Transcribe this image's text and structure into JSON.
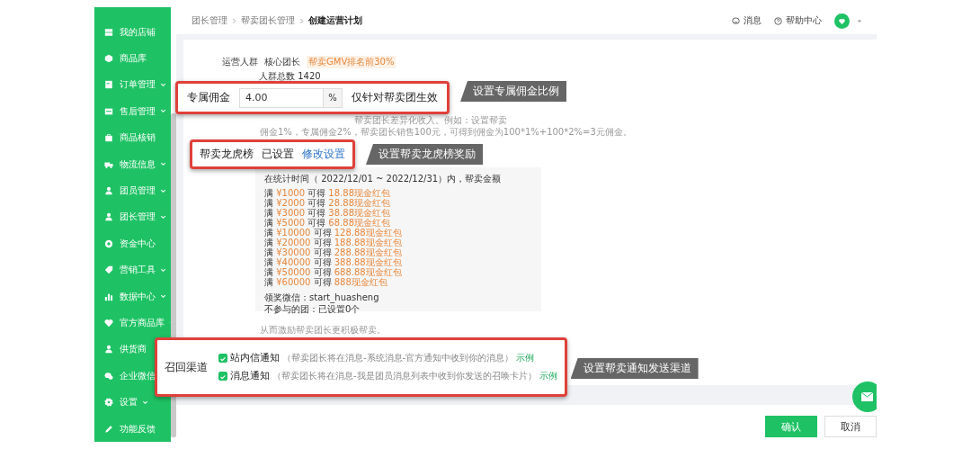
{
  "sidebar": {
    "items": [
      {
        "label": "我的店铺",
        "has_submenu": false
      },
      {
        "label": "商品库",
        "has_submenu": false
      },
      {
        "label": "订单管理",
        "has_submenu": true
      },
      {
        "label": "售后管理",
        "has_submenu": true
      },
      {
        "label": "商品核销",
        "has_submenu": false
      },
      {
        "label": "物流信息",
        "has_submenu": true
      },
      {
        "label": "团员管理",
        "has_submenu": true
      },
      {
        "label": "团长管理",
        "has_submenu": true
      },
      {
        "label": "资金中心",
        "has_submenu": false
      },
      {
        "label": "营销工具",
        "has_submenu": true
      },
      {
        "label": "数据中心",
        "has_submenu": true
      },
      {
        "label": "官方商品库",
        "has_submenu": true
      },
      {
        "label": "供货商",
        "has_submenu": false
      },
      {
        "label": "企业微信",
        "has_submenu": false
      },
      {
        "label": "设置",
        "has_submenu": true
      },
      {
        "label": "功能反馈",
        "has_submenu": false
      }
    ]
  },
  "header": {
    "breadcrumb": [
      {
        "label": "团长管理",
        "current": false
      },
      {
        "label": "帮卖团长管理",
        "current": false
      },
      {
        "label": "创建运营计划",
        "current": true
      }
    ],
    "messages": "消息",
    "help": "帮助中心"
  },
  "form": {
    "audience": {
      "label": "运营人群",
      "value": "核心团长",
      "tag": "帮卖GMV排名前30%",
      "total": "人群总数 1420"
    },
    "commission": {
      "label": "专属佣金",
      "value": "4.00",
      "unit": "%",
      "note": "仅针对帮卖团生效",
      "callout": "设置专属佣金比例",
      "description": [
        "帮卖团长差异化收入。例如：设置帮卖",
        "佣金1%，专属佣金2%，帮卖团长销售100元，可得到佣金为100*1%+100*2%=3元佣金。"
      ]
    },
    "leaderboard": {
      "label": "帮卖龙虎榜",
      "status": "已设置",
      "edit_link": "修改设置",
      "callout": "设置帮卖龙虎榜奖励",
      "period": "在统计时间（ 2022/12/01 ~ 2022/12/31）内，帮卖金额",
      "tiers": [
        {
          "prefix": "满",
          "threshold": "¥1000",
          "middle": "可得",
          "reward": "18.88现金红包"
        },
        {
          "prefix": "满",
          "threshold": "¥2000",
          "middle": "可得",
          "reward": "28.88现金红包"
        },
        {
          "prefix": "满",
          "threshold": "¥3000",
          "middle": "可得",
          "reward": "38.88现金红包"
        },
        {
          "prefix": "满",
          "threshold": "¥5000",
          "middle": "可得",
          "reward": "68.88现金红包"
        },
        {
          "prefix": "满",
          "threshold": "¥10000",
          "middle": "可得",
          "reward": "128.88现金红包"
        },
        {
          "prefix": "满",
          "threshold": "¥20000",
          "middle": "可得",
          "reward": "188.88现金红包"
        },
        {
          "prefix": "满",
          "threshold": "¥30000",
          "middle": "可得",
          "reward": "288.88现金红包"
        },
        {
          "prefix": "满",
          "threshold": "¥40000",
          "middle": "可得",
          "reward": "388.88现金红包"
        },
        {
          "prefix": "满",
          "threshold": "¥50000",
          "middle": "可得",
          "reward": "688.88现金红包"
        },
        {
          "prefix": "满",
          "threshold": "¥60000",
          "middle": "可得",
          "reward": "888现金红包"
        }
      ],
      "wechat": "领奖微信：start_huasheng",
      "excluded": "不参与的团：已设置0个",
      "description": "从而激励帮卖团长更积极帮卖。"
    },
    "recall": {
      "label": "召回渠道",
      "callout": "设置帮卖通知发送渠道",
      "channels": [
        {
          "label": "站内信通知",
          "hint": "（帮卖团长将在消息-系统消息-官方通知中收到你的消息）",
          "example": "示例",
          "checked": true
        },
        {
          "label": "消息通知",
          "hint": "（帮卖团长将在消息-我是团员消息列表中收到你发送的召唤卡片）",
          "example": "示例",
          "checked": true
        }
      ]
    }
  },
  "footer": {
    "buttons": [
      {
        "label": "确认",
        "kind": "primary"
      },
      {
        "label": "取消",
        "kind": "default"
      }
    ]
  }
}
